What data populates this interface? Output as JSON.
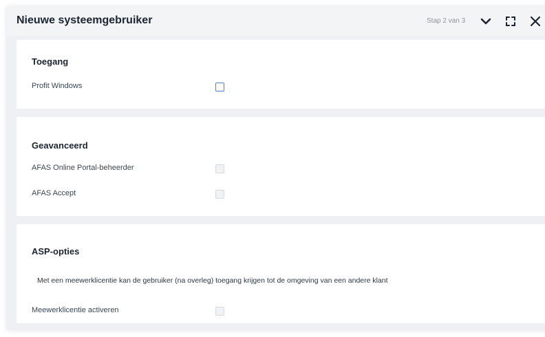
{
  "dialog": {
    "title": "Nieuwe systeemgebruiker",
    "step": "Stap 2 van 3"
  },
  "sections": {
    "access": {
      "title": "Toegang",
      "items": [
        {
          "label": "Profit Windows",
          "checked": false,
          "enabled": true
        }
      ]
    },
    "advanced": {
      "title": "Geavanceerd",
      "items": [
        {
          "label": "AFAS Online Portal-beheerder",
          "checked": false,
          "enabled": false
        },
        {
          "label": "AFAS Accept",
          "checked": false,
          "enabled": false
        }
      ]
    },
    "asp": {
      "title": "ASP-opties",
      "description": "Met een meewerklicentie kan de gebruiker (na overleg) toegang krijgen tot de omgeving van een andere klant",
      "items": [
        {
          "label": "Meewerklicentie activeren",
          "checked": false,
          "enabled": false
        }
      ]
    }
  },
  "icons": {
    "collapse": "chevron-down-icon",
    "maximize": "maximize-icon",
    "close": "close-icon"
  },
  "colors": {
    "accent": "#4a86d4",
    "panel_background": "#eef0f3",
    "card_background": "#ffffff"
  }
}
